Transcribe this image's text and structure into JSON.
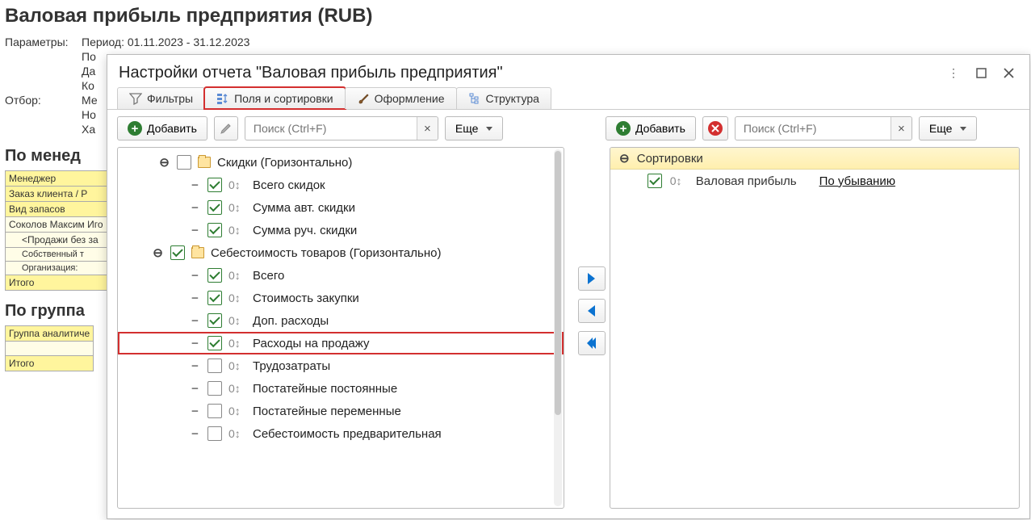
{
  "bg": {
    "title": "Валовая прибыль предприятия (RUB)",
    "param_label": "Параметры:",
    "period": "Период: 01.11.2023 - 31.12.2023",
    "lines": [
      "По",
      "Да",
      "Ко"
    ],
    "otbor_label": "Отбор:",
    "otbor_lines": [
      "Ме",
      "Но",
      "Ха"
    ],
    "section1": "По менед",
    "tbl1": {
      "r1": "Менеджер",
      "r2": "Заказ клиента / Р",
      "r3": "Вид запасов",
      "r4": "Соколов Максим Иго",
      "r5": "<Продажи без за",
      "r6": "Собственный т",
      "r7": "Организация:",
      "r8": "Итого"
    },
    "section2": "По группа",
    "tbl2": {
      "r1": "Группа аналитиче",
      "r2": "",
      "r3": "Итого"
    }
  },
  "dialog": {
    "title": "Настройки отчета \"Валовая прибыль предприятия\"",
    "tabs": {
      "filters": "Фильтры",
      "fields": "Поля и сортировки",
      "design": "Оформление",
      "structure": "Структура"
    },
    "toolbar": {
      "add": "Добавить",
      "more": "Еще",
      "search_ph": "Поиск (Ctrl+F)"
    },
    "tree": {
      "g1": {
        "label": "Скидки (Горизонтально)",
        "c1": "Всего скидок",
        "c2": "Сумма авт. скидки",
        "c3": "Сумма руч. скидки"
      },
      "g2": {
        "label": "Себестоимость товаров (Горизонтально)",
        "c1": "Всего",
        "c2": "Стоимость закупки",
        "c3": "Доп. расходы",
        "c4": "Расходы на продажу",
        "c5": "Трудозатраты",
        "c6": "Постатейные постоянные",
        "c7": "Постатейные переменные",
        "c8": "Себестоимость предварительная"
      },
      "oz": "0↕"
    },
    "sort": {
      "header": "Сортировки",
      "item": "Валовая прибыль",
      "dir": "По убыванию"
    }
  }
}
